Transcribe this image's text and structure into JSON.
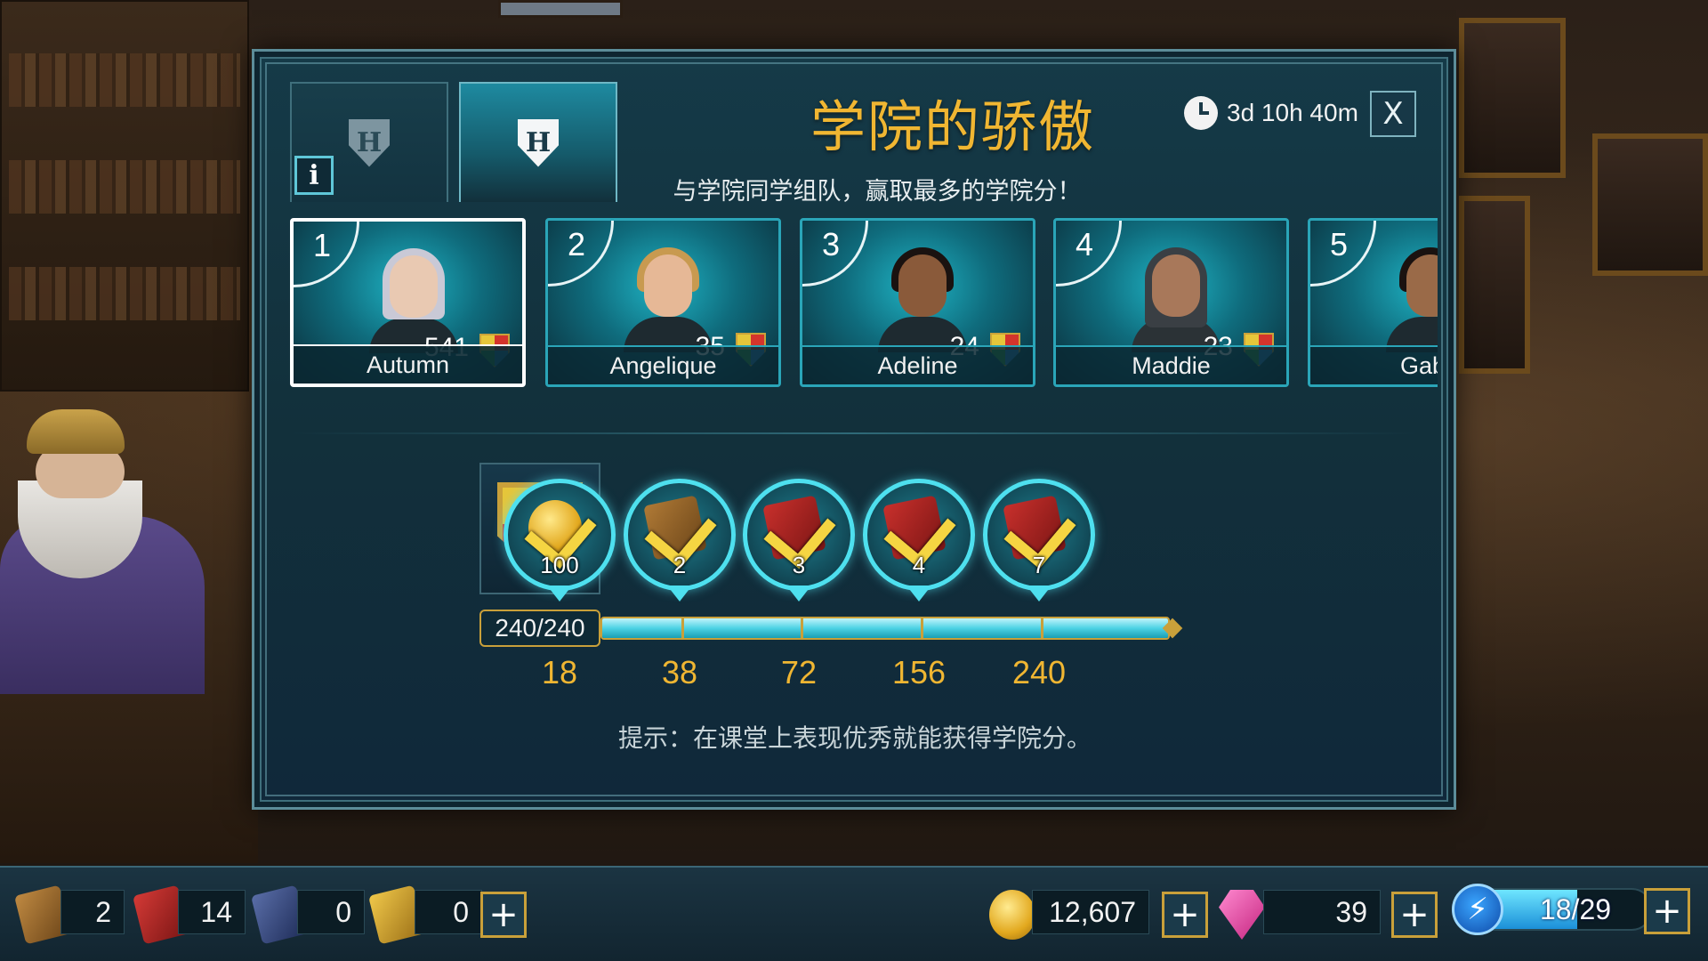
{
  "modal": {
    "title": "学院的骄傲",
    "timer": "3d 10h 40m",
    "close_label": "X",
    "info_label": "i",
    "tab_inactive_icon": "H",
    "tab_active_icon": "H",
    "subtitle": "与学院同学组队，赢取最多的学院分！",
    "hint": "提示：在课堂上表现优秀就能获得学院分。"
  },
  "players": [
    {
      "rank": "1",
      "name": "Autumn",
      "points": "541",
      "selected": true
    },
    {
      "rank": "2",
      "name": "Angelique",
      "points": "35",
      "selected": false
    },
    {
      "rank": "3",
      "name": "Adeline",
      "points": "24",
      "selected": false
    },
    {
      "rank": "4",
      "name": "Maddie",
      "points": "23",
      "selected": false
    },
    {
      "rank": "5",
      "name": "Gabi",
      "points": "",
      "selected": false
    }
  ],
  "progress": {
    "label": "240/240",
    "current": 240,
    "max": 240
  },
  "milestones": [
    {
      "threshold": "18",
      "reward": "coin",
      "qty": "100"
    },
    {
      "threshold": "38",
      "reward": "book-brown",
      "qty": "2"
    },
    {
      "threshold": "72",
      "reward": "book-red",
      "qty": "3"
    },
    {
      "threshold": "156",
      "reward": "book-red",
      "qty": "4"
    },
    {
      "threshold": "240",
      "reward": "book-red",
      "qty": "7"
    }
  ],
  "resources": {
    "book_brown": "2",
    "book_red": "14",
    "book_blue": "0",
    "book_gold": "0",
    "coins": "12,607",
    "gems": "39",
    "energy": "18/29",
    "energy_current": 18,
    "energy_max": 29,
    "plus_label": "+"
  },
  "colors": {
    "title_gold": "#f0b632",
    "accent_cyan": "#4ee0ef",
    "panel_teal": "#153a48"
  }
}
